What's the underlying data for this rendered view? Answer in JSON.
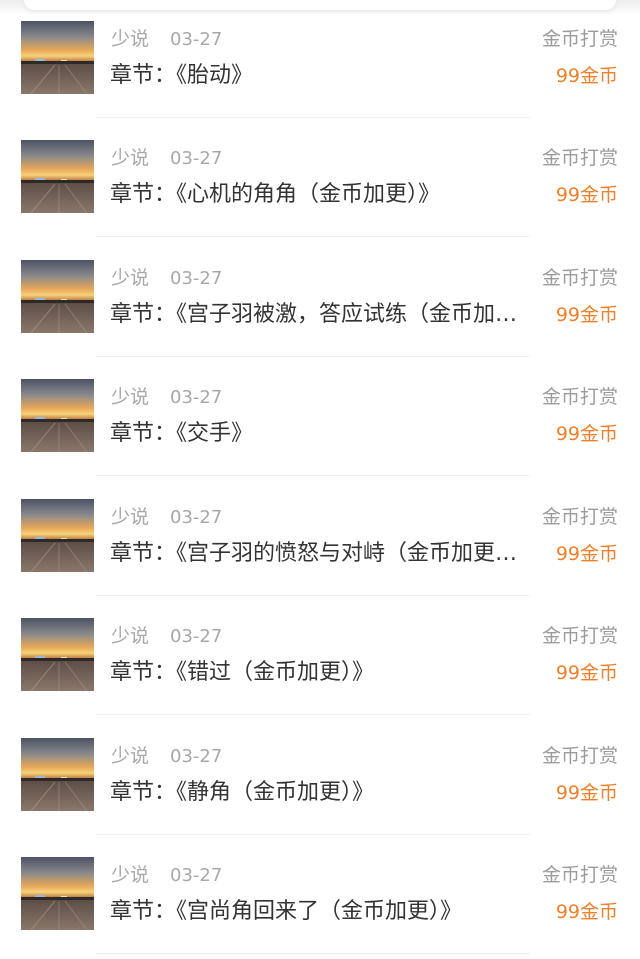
{
  "records": [
    {
      "user": "少说",
      "date": "03-27",
      "chapter": "章节：《胎动》",
      "tip_label": "金币打赏",
      "tip_amount": "99金币"
    },
    {
      "user": "少说",
      "date": "03-27",
      "chapter": "章节：《心机的角角（金币加更）》",
      "tip_label": "金币打赏",
      "tip_amount": "99金币"
    },
    {
      "user": "少说",
      "date": "03-27",
      "chapter": "章节：《宫子羽被激，答应试练（金币加更）》",
      "tip_label": "金币打赏",
      "tip_amount": "99金币"
    },
    {
      "user": "少说",
      "date": "03-27",
      "chapter": "章节：《交手》",
      "tip_label": "金币打赏",
      "tip_amount": "99金币"
    },
    {
      "user": "少说",
      "date": "03-27",
      "chapter": "章节：《宫子羽的愤怒与对峙（金币加更）》",
      "tip_label": "金币打赏",
      "tip_amount": "99金币"
    },
    {
      "user": "少说",
      "date": "03-27",
      "chapter": "章节：《错过（金币加更）》",
      "tip_label": "金币打赏",
      "tip_amount": "99金币"
    },
    {
      "user": "少说",
      "date": "03-27",
      "chapter": "章节：《静角（金币加更）》",
      "tip_label": "金币打赏",
      "tip_amount": "99金币"
    },
    {
      "user": "少说",
      "date": "03-27",
      "chapter": "章节：《宫尚角回来了（金币加更）》",
      "tip_label": "金币打赏",
      "tip_amount": "99金币"
    }
  ]
}
